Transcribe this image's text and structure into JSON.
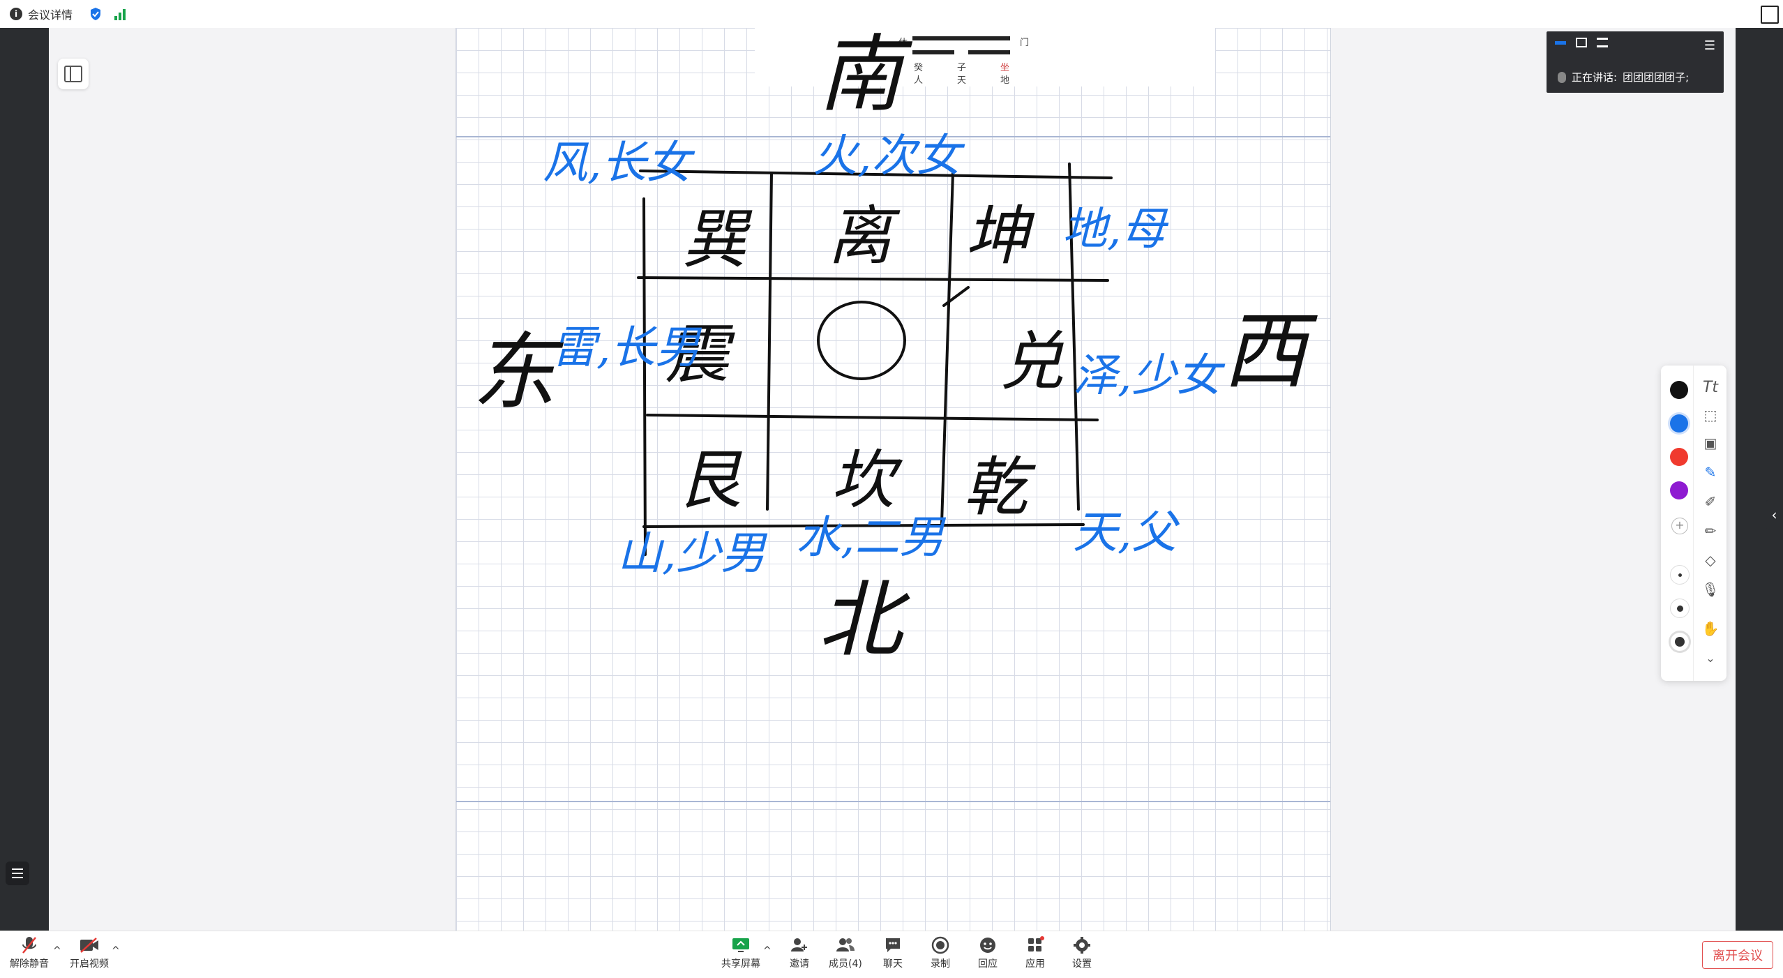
{
  "topbar": {
    "meeting_details": "会议详情"
  },
  "speaker_panel": {
    "label": "正在讲话:",
    "name": "团团团团团子;"
  },
  "whiteboard": {
    "reference_image": {
      "labels": [
        "休",
        "门",
        "癸",
        "子",
        "坐",
        "人",
        "天",
        "地"
      ]
    },
    "handwriting": {
      "directions": {
        "south": "南",
        "north": "北",
        "east": "东",
        "west": "西"
      },
      "trigrams": [
        "巽",
        "离",
        "坤",
        "震",
        "兑",
        "艮",
        "坎",
        "乾"
      ],
      "annotations": [
        "风,长女",
        "火,次女",
        "地,母",
        "雷,长男",
        "泽,少女",
        "山,少男",
        "水,二男",
        "天,父"
      ]
    }
  },
  "annotation_toolbar": {
    "colors": [
      "#111111",
      "#1a73e8",
      "#f03a2e",
      "#8e1bd1"
    ],
    "selected_color": "#1a73e8",
    "tools": [
      "text-tool-icon",
      "select-rect-icon",
      "image-icon",
      "pen-icon",
      "marker-icon",
      "highlighter-icon",
      "eraser-icon",
      "mic-icon",
      "hand-icon",
      "chevron-down-icon"
    ]
  },
  "bottombar": {
    "unmute": "解除静音",
    "start_video": "开启视频",
    "share_screen": "共享屏幕",
    "invite": "邀请",
    "members": "成员(4)",
    "chat": "聊天",
    "record": "录制",
    "reply": "回应",
    "apps": "应用",
    "settings": "设置",
    "leave": "离开会议"
  }
}
